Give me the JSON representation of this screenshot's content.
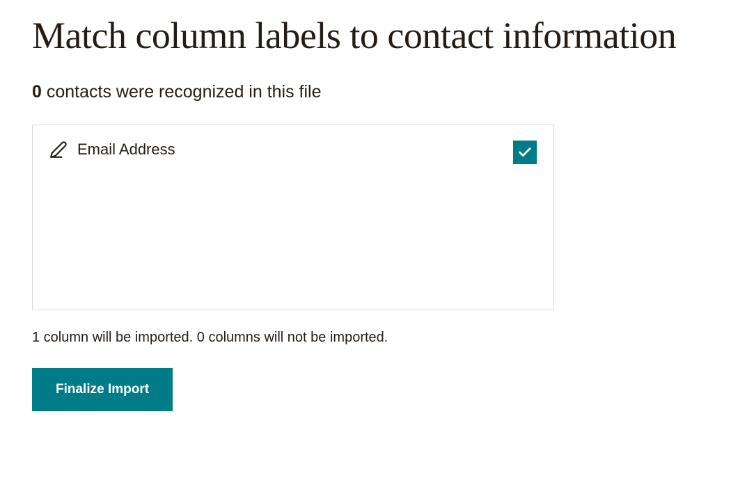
{
  "page": {
    "title": "Match column labels to contact information"
  },
  "status": {
    "count": "0",
    "text": "contacts were recognized in this file"
  },
  "column": {
    "label": "Email Address"
  },
  "summary": {
    "text": "1 column will be imported. 0 columns will not be imported."
  },
  "actions": {
    "finalize": "Finalize Import"
  }
}
